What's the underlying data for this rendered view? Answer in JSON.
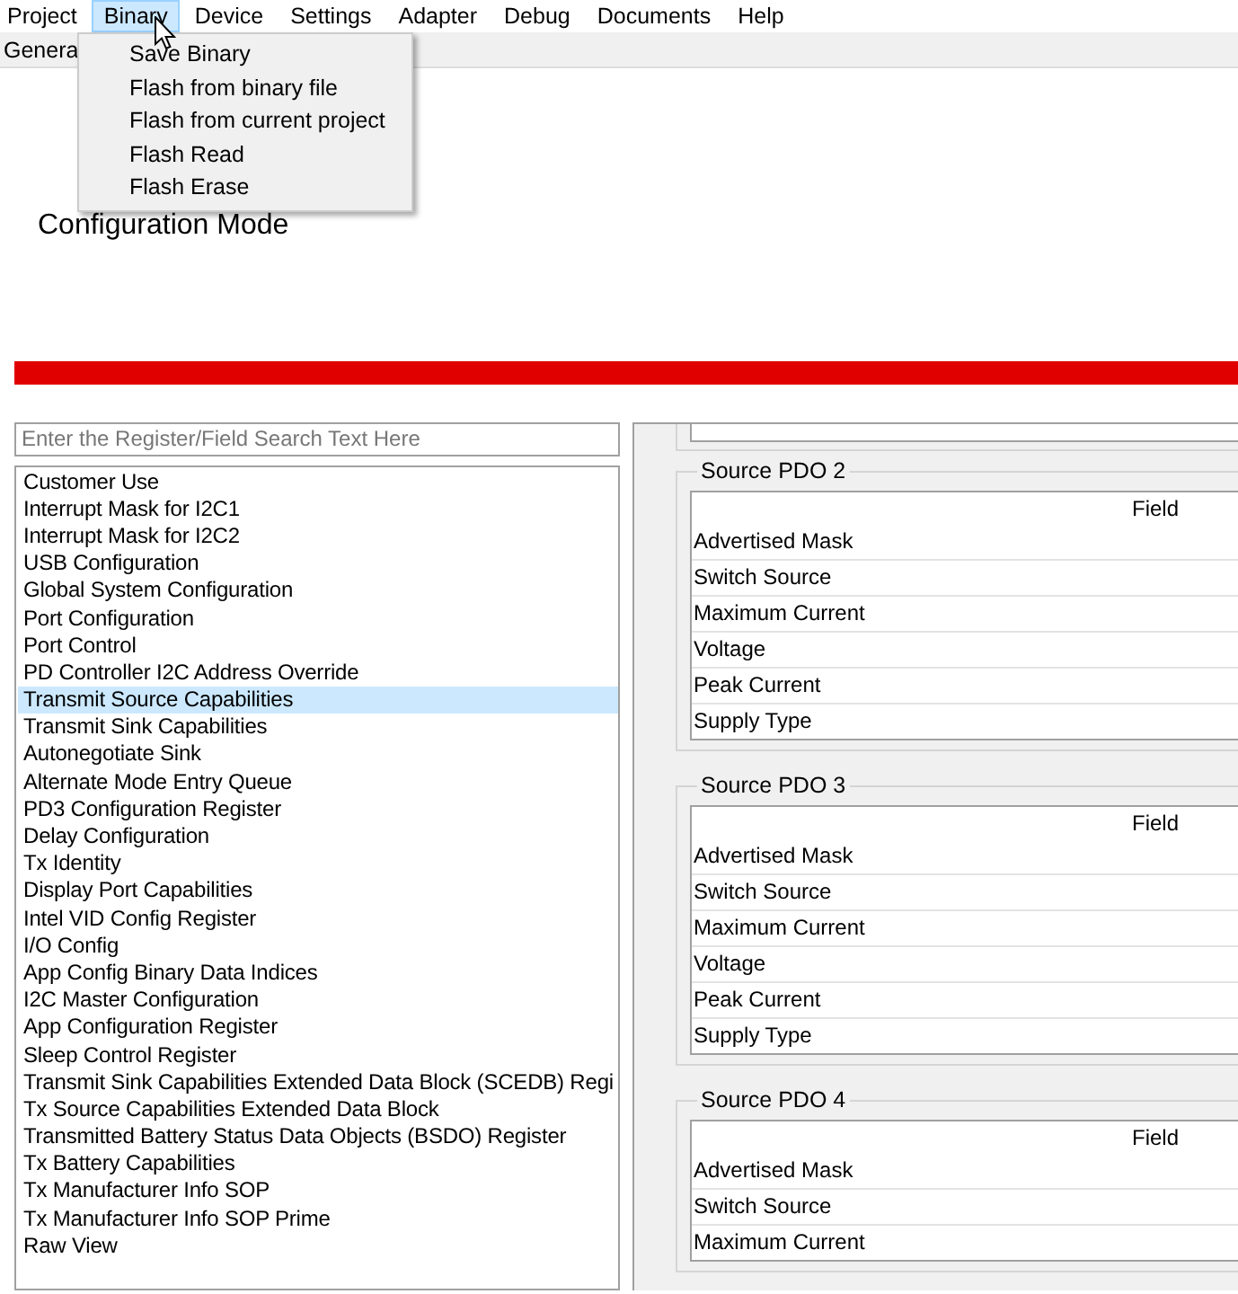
{
  "menu_bar": {
    "items": [
      {
        "label": "Project",
        "selected": false
      },
      {
        "label": "Binary",
        "selected": true
      },
      {
        "label": "Device",
        "selected": false
      },
      {
        "label": "Settings",
        "selected": false
      },
      {
        "label": "Adapter",
        "selected": false
      },
      {
        "label": "Debug",
        "selected": false
      },
      {
        "label": "Documents",
        "selected": false
      },
      {
        "label": "Help",
        "selected": false
      }
    ]
  },
  "binary_menu": {
    "items": [
      "Save Binary",
      "Flash from binary file",
      "Flash from current project",
      "Flash Read",
      "Flash Erase"
    ]
  },
  "tab_strip": {
    "tabs": [
      "Genera"
    ]
  },
  "heading": "Configuration Mode",
  "search": {
    "placeholder": "Enter the Register/Field Search Text Here"
  },
  "register_list": {
    "items": [
      {
        "label": "Customer Use",
        "selected": false
      },
      {
        "label": "Interrupt Mask for I2C1",
        "selected": false
      },
      {
        "label": "Interrupt Mask for I2C2",
        "selected": false
      },
      {
        "label": "USB Configuration",
        "selected": false
      },
      {
        "label": "Global System Configuration",
        "selected": false
      },
      {
        "label": "Port Configuration",
        "selected": false
      },
      {
        "label": "Port Control",
        "selected": false
      },
      {
        "label": "PD Controller I2C Address Override",
        "selected": false
      },
      {
        "label": "Transmit Source Capabilities",
        "selected": true
      },
      {
        "label": "Transmit Sink Capabilities",
        "selected": false
      },
      {
        "label": "Autonegotiate Sink",
        "selected": false
      },
      {
        "label": "Alternate Mode Entry Queue",
        "selected": false
      },
      {
        "label": "PD3 Configuration Register",
        "selected": false
      },
      {
        "label": "Delay Configuration",
        "selected": false
      },
      {
        "label": "Tx Identity",
        "selected": false
      },
      {
        "label": "Display Port Capabilities",
        "selected": false
      },
      {
        "label": "Intel VID Config Register",
        "selected": false
      },
      {
        "label": "I/O Config",
        "selected": false
      },
      {
        "label": "App Config Binary Data Indices",
        "selected": false
      },
      {
        "label": "I2C Master Configuration",
        "selected": false
      },
      {
        "label": "App Configuration Register",
        "selected": false
      },
      {
        "label": "Sleep Control Register",
        "selected": false
      },
      {
        "label": "Transmit Sink Capabilities Extended Data Block (SCEDB) Regi",
        "selected": false
      },
      {
        "label": "Tx Source Capabilities Extended Data Block",
        "selected": false
      },
      {
        "label": "Transmitted Battery Status Data Objects (BSDO) Register",
        "selected": false
      },
      {
        "label": "Tx Battery Capabilities",
        "selected": false
      },
      {
        "label": "Tx Manufacturer Info SOP",
        "selected": false
      },
      {
        "label": "Tx Manufacturer Info SOP Prime",
        "selected": false
      },
      {
        "label": "Raw View",
        "selected": false
      }
    ]
  },
  "groups": [
    {
      "title": "Source PDO 2",
      "column": "Field",
      "rows": [
        "Advertised Mask",
        "Switch Source",
        "Maximum Current",
        "Voltage",
        "Peak Current",
        "Supply Type"
      ]
    },
    {
      "title": "Source PDO 3",
      "column": "Field",
      "rows": [
        "Advertised Mask",
        "Switch Source",
        "Maximum Current",
        "Voltage",
        "Peak Current",
        "Supply Type"
      ]
    },
    {
      "title": "Source PDO 4",
      "column": "Field",
      "rows": [
        "Advertised Mask",
        "Switch Source",
        "Maximum Current"
      ]
    }
  ]
}
